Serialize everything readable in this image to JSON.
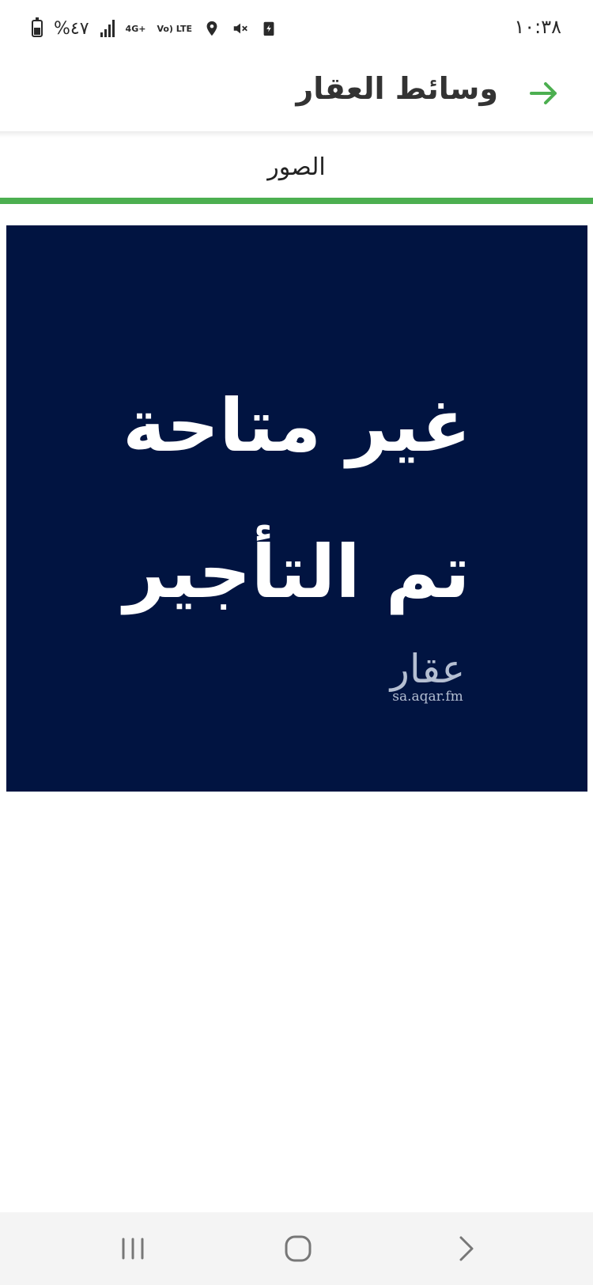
{
  "status_bar": {
    "time": "١٠:٣٨",
    "battery": "%٤٧",
    "network": "4G+",
    "volte": "Vo) LTE",
    "icons": [
      "battery-icon",
      "signal-icon",
      "network-4g-icon",
      "volte-icon",
      "location-icon",
      "mute-icon",
      "battery-saver-icon"
    ]
  },
  "app_bar": {
    "title": "وسائط العقار",
    "back_icon": "arrow-right-icon",
    "accent_color": "#4caf50"
  },
  "tabs": [
    {
      "label": "الصور",
      "active": true
    }
  ],
  "media": {
    "background_color": "#011441",
    "text_line1": "غير متاحة",
    "text_line2": "تم التأجير",
    "watermark_logo": "عقار",
    "watermark_url": "sa.aqar.fm"
  },
  "nav_bar": {
    "icons": [
      "recents-icon",
      "home-icon",
      "back-icon"
    ]
  }
}
